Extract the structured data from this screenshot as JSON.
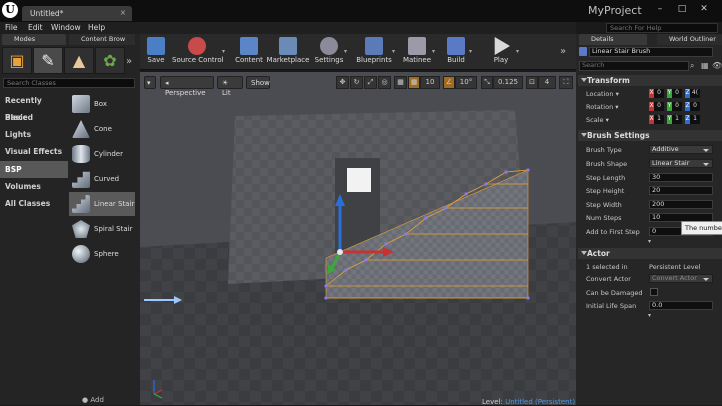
{
  "title_bar": {
    "tab": "Untitled*",
    "project": "MyProject"
  },
  "menu": [
    "File",
    "Edit",
    "Window",
    "Help"
  ],
  "search_help": {
    "placeholder": "Search For Help"
  },
  "modes_panel": {
    "tab_modes": "Modes",
    "tab_content": "Content Brow",
    "search_placeholder": "Search Classes",
    "categories": [
      "Recently Placed",
      "Basic",
      "Lights",
      "Visual Effects",
      "BSP",
      "Volumes",
      "All Classes"
    ],
    "selected_category": "BSP",
    "items": [
      "Box",
      "Cone",
      "Cylinder",
      "Curved Stair",
      "Linear Stair",
      "Spiral Stair",
      "Sphere"
    ],
    "selected_item": "Linear Stair",
    "add_label": "Add"
  },
  "toolbar": [
    {
      "label": "Save",
      "color": "#4a7fc6"
    },
    {
      "label": "Source Control",
      "color": "#c84a4a"
    },
    {
      "label": "Content",
      "color": "#5a86c8"
    },
    {
      "label": "Marketplace",
      "color": "#6a8ab8"
    },
    {
      "label": "Settings",
      "color": "#8a8a9a"
    },
    {
      "label": "Blueprints",
      "color": "#5a7ab8"
    },
    {
      "label": "Matinee",
      "color": "#9a9aa8"
    },
    {
      "label": "Build",
      "color": "#5a7ac8"
    },
    {
      "label": "Play",
      "color": "#d8d8d8"
    }
  ],
  "viewport": {
    "perspective": "Perspective",
    "lit": "Lit",
    "show": "Show",
    "grid_snap": "10",
    "rot_snap": "10°",
    "scale_snap": "0.125",
    "cam_speed": "4",
    "level_label": "Level:",
    "level_name": "Untitled (Persistent)"
  },
  "details": {
    "tab_details": "Details",
    "tab_outliner": "World Outliner",
    "actor_name": "Linear Stair Brush",
    "search_placeholder": "Search",
    "transform": {
      "title": "Transform",
      "location_label": "Location",
      "rotation_label": "Rotation",
      "scale_label": "Scale",
      "location": [
        "0",
        "0",
        "4("
      ],
      "rotation": [
        "0",
        "0",
        "0"
      ],
      "scale": [
        "1",
        "1",
        "1"
      ]
    },
    "brush_settings": {
      "title": "Brush Settings",
      "brush_type_label": "Brush Type",
      "brush_type": "Additive",
      "brush_shape_label": "Brush Shape",
      "brush_shape": "Linear Stair",
      "step_length_label": "Step Length",
      "step_length": "30",
      "step_height_label": "Step Height",
      "step_height": "20",
      "step_width_label": "Step Width",
      "step_width": "200",
      "num_steps_label": "Num Steps",
      "num_steps": "10",
      "add_first_label": "Add to First Step",
      "add_first": "0"
    },
    "actor": {
      "title": "Actor",
      "selected_label": "1 selected in",
      "level_value": "Persistent Level",
      "convert_label": "Convert Actor",
      "convert_value": "Convert Actor",
      "can_damage_label": "Can be Damaged",
      "life_span_label": "Initial Life Span",
      "life_span": "0.0"
    }
  },
  "tooltip": "The number",
  "colors": {
    "axis_x": "#c83232",
    "axis_y": "#3aa83a",
    "axis_z": "#2a6fd8",
    "selection": "#e8a23a"
  }
}
